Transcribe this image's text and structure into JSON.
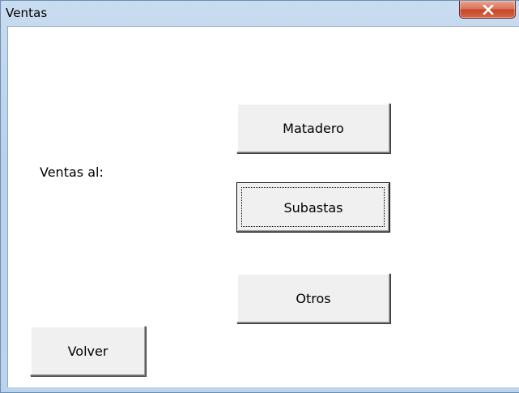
{
  "window": {
    "title": "Ventas"
  },
  "titlebar": {
    "close_icon": "close-icon"
  },
  "form": {
    "label": "Ventas al:",
    "buttons": {
      "matadero": "Matadero",
      "subastas": "Subastas",
      "otros": "Otros",
      "volver": "Volver"
    }
  },
  "colors": {
    "close_button": "#c8452a",
    "titlebar": "#bcd3ec"
  }
}
